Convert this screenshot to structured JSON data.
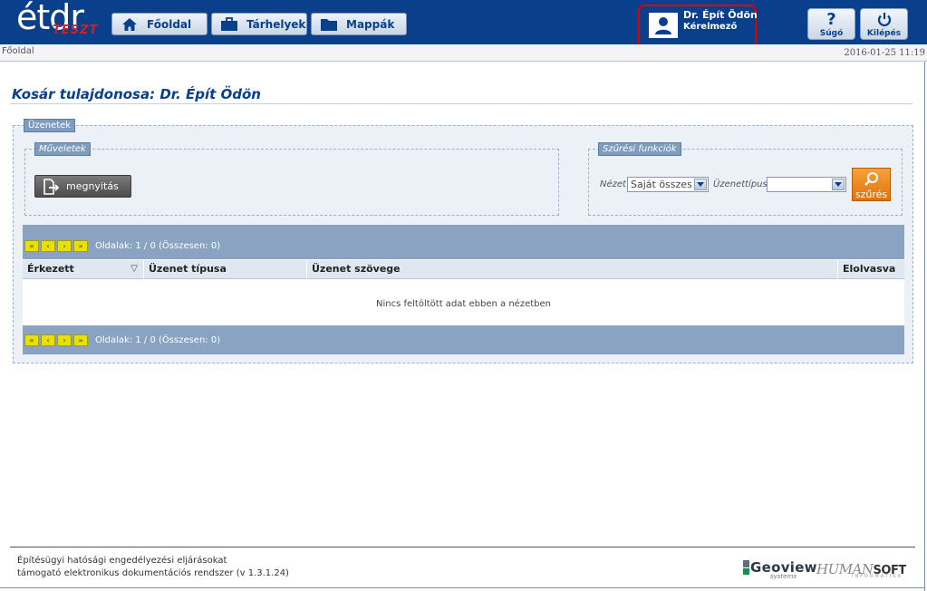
{
  "header": {
    "logo_text": "étdr",
    "logo_sub": "TESZT",
    "nav": [
      {
        "label": "Főoldal",
        "icon": "home-icon"
      },
      {
        "label": "Tárhelyek",
        "icon": "briefcase-icon"
      },
      {
        "label": "Mappák",
        "icon": "folder-icon"
      }
    ],
    "user": {
      "name": "Dr. Épít Ödön",
      "role": "Kérelmező",
      "icon": "user-icon"
    },
    "help_label": "Súgó",
    "logout_label": "Kilépés"
  },
  "breadcrumb": "Főoldal",
  "datetime": "2016-01-25 11:19",
  "page_title": "Kosár tulajdonosa: Dr. Épít Ödön",
  "messages": {
    "legend": "Üzenetek",
    "operations": {
      "legend": "Műveletek",
      "open_label": "megnyitás"
    },
    "filter": {
      "legend": "Szűrési funkciók",
      "view_label": "Nézet",
      "view_value": "Saját összes",
      "type_label": "Üzenettípus",
      "type_value": "",
      "search_label": "szűrés"
    },
    "grid": {
      "pager_info": "Oldalak: 1 / 0 (Összesen: 0)",
      "columns": [
        "Érkezett",
        "Üzenet típusa",
        "Üzenet szövege",
        "Elolvasva"
      ],
      "sort_indicator": "▽",
      "empty_message": "Nincs feltöltött adat ebben a nézetben"
    }
  },
  "footer": {
    "line1": "Építésügyi hatósági engedélyezési eljárásokat",
    "line2": "támogató elektronikus dokumentációs rendszer (v 1.3.1.24)",
    "geoview": "Geoview",
    "geoview_sub": "systems",
    "humansoft": "HUMAN",
    "humansoft_b": "SOFT",
    "humansoft_sub": "INFORMATIKA"
  },
  "colors": {
    "header_bg": "#0a3f8c",
    "accent_orange": "#e0720c",
    "highlight_red": "#e00000",
    "pager_bg": "#8aa3c2"
  }
}
